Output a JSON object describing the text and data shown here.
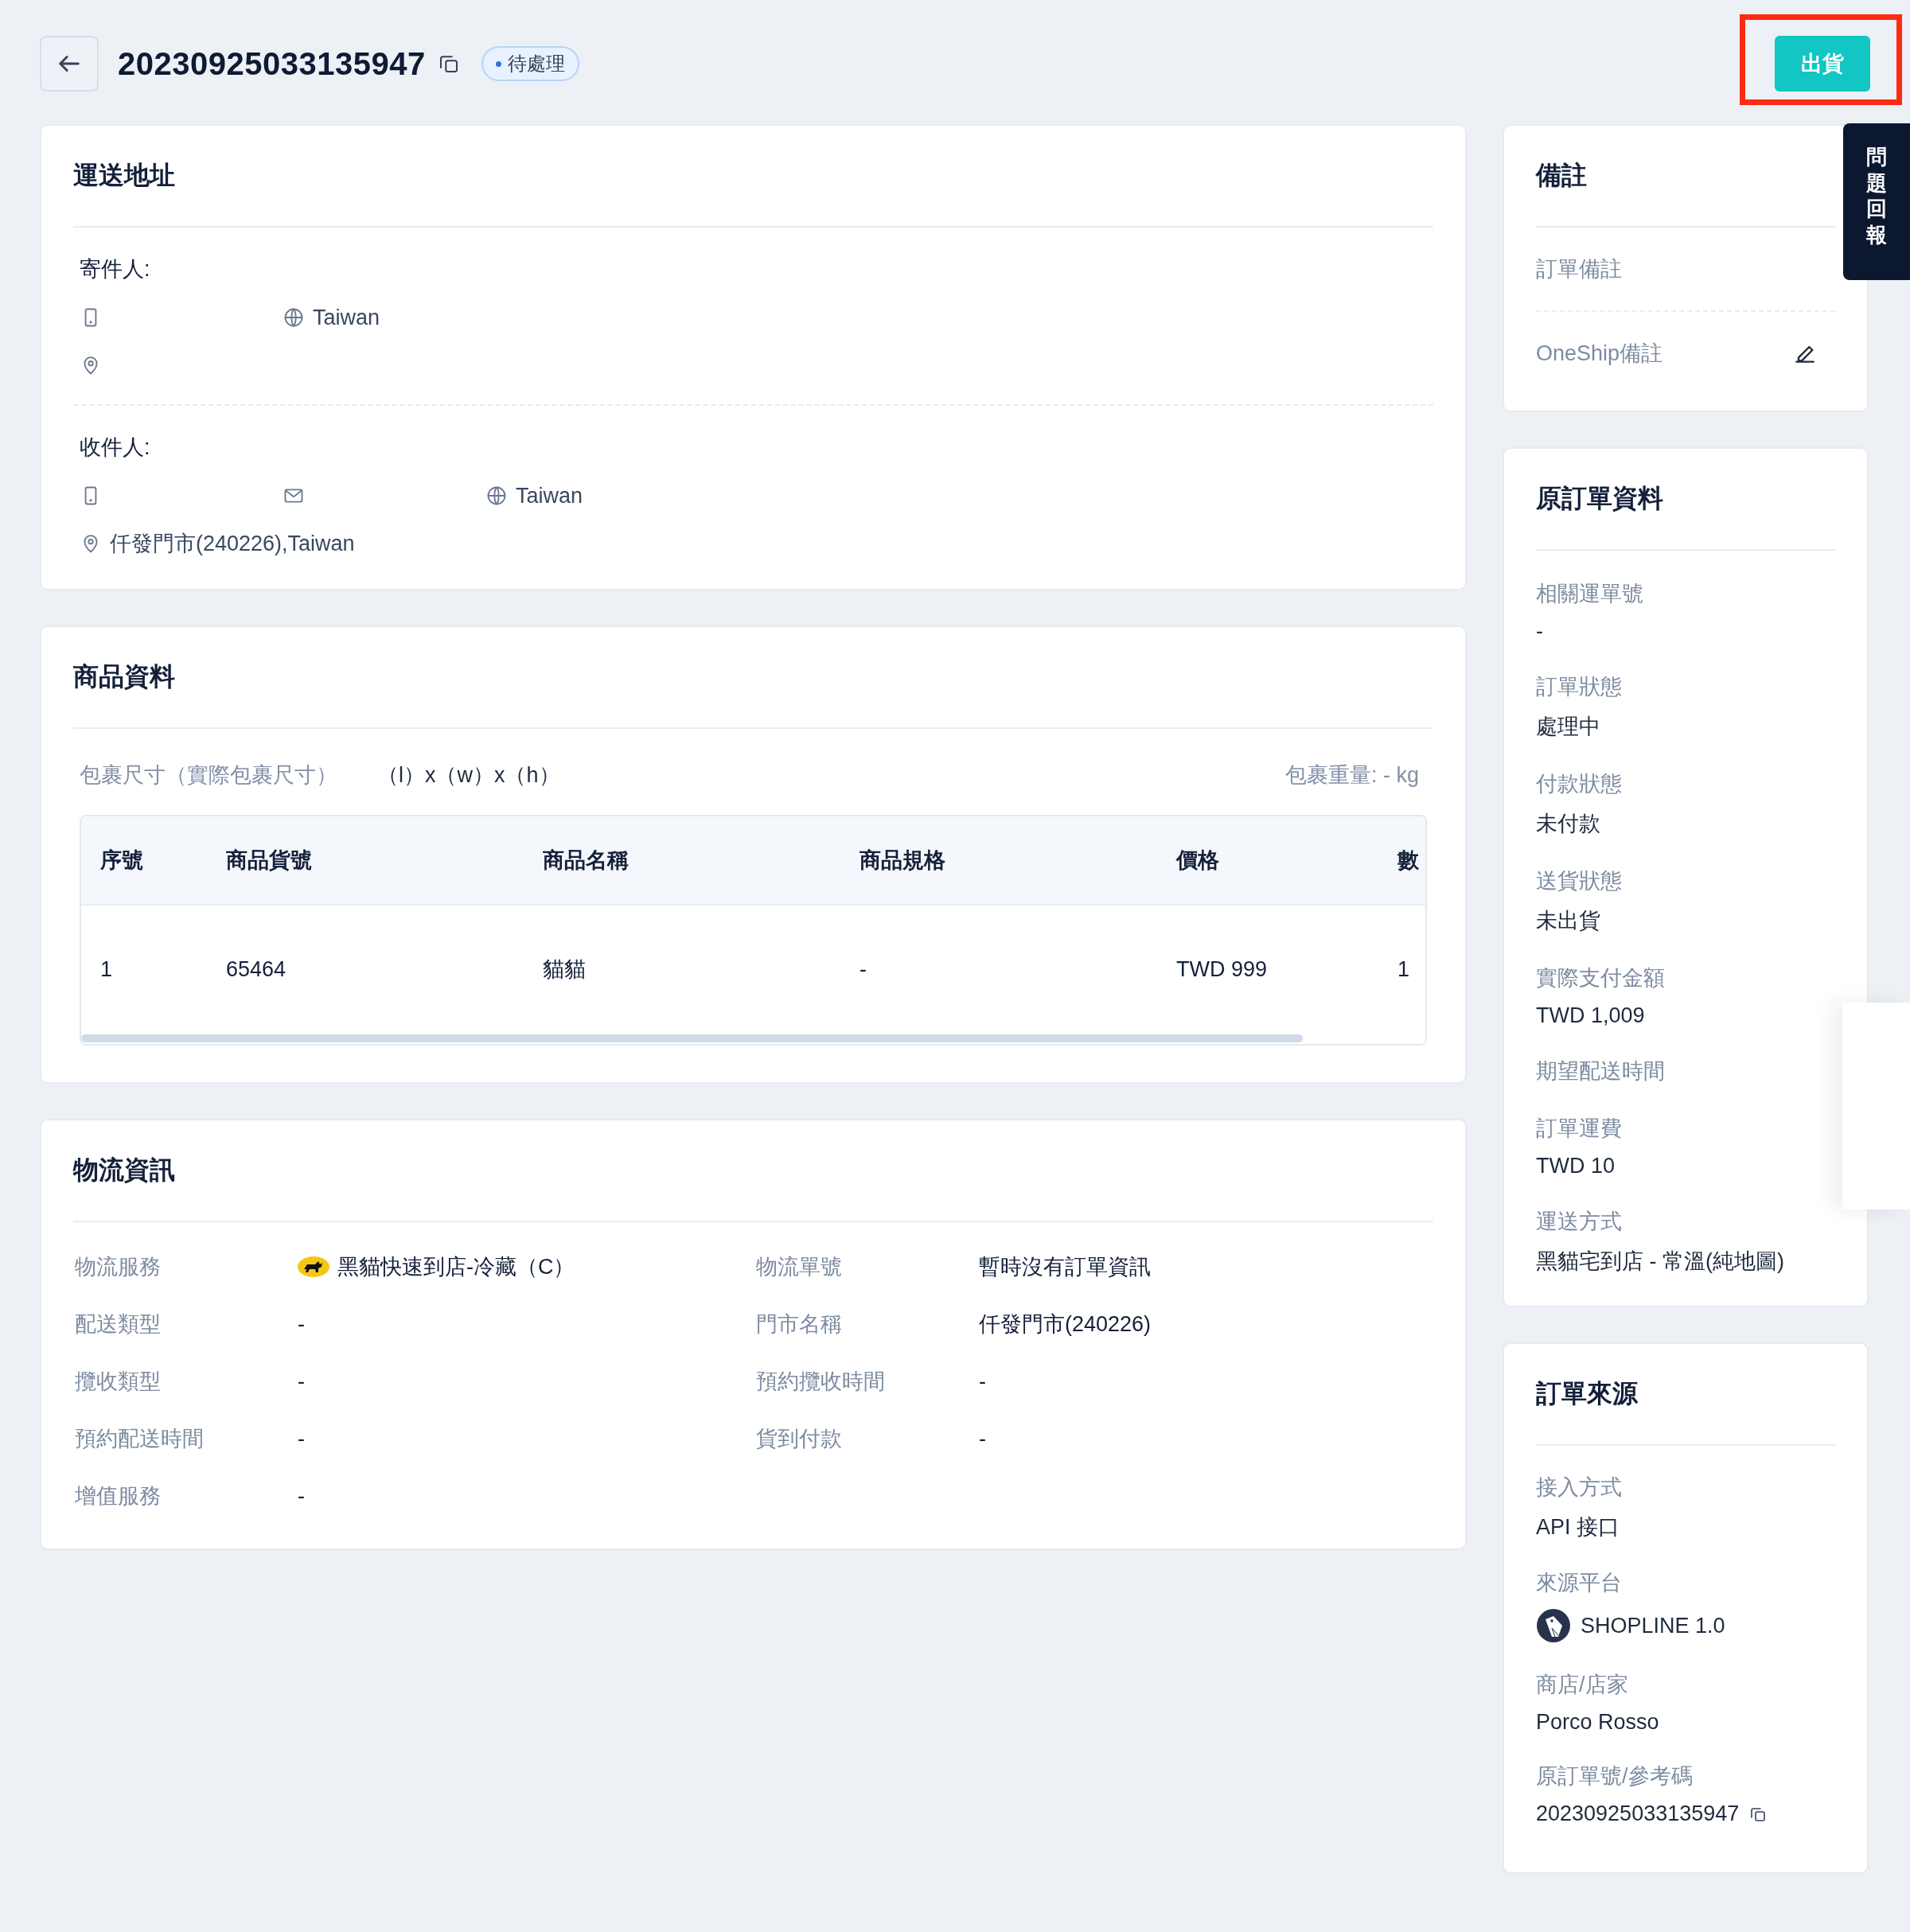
{
  "header": {
    "order_number": "20230925033135947",
    "status": "待處理",
    "ship_button": "出貨",
    "feedback_tab": "問題回報"
  },
  "shipping_address": {
    "title": "運送地址",
    "parties": [
      {
        "label": "寄件人:",
        "contacts": [
          {
            "kind": "phone"
          },
          {
            "kind": "country",
            "text": "Taiwan"
          }
        ]
      },
      {
        "label": "收件人:",
        "contacts": [
          {
            "kind": "phone"
          },
          {
            "kind": "email"
          },
          {
            "kind": "country",
            "text": "Taiwan"
          }
        ],
        "address": "仟發門市(240226),Taiwan"
      }
    ]
  },
  "products": {
    "title": "商品資料",
    "size_label": "包裹尺寸（實際包裹尺寸）",
    "size_value": "（l）x（w）x（h）",
    "weight": "包裹重量: - kg",
    "columns": [
      "序號",
      "商品貨號",
      "商品名稱",
      "商品規格",
      "價格",
      "數"
    ],
    "rows": [
      [
        "1",
        "65464",
        "貓貓",
        "-",
        "TWD 999",
        "1"
      ]
    ]
  },
  "logistics": {
    "title": "物流資訊",
    "left": [
      {
        "label": "物流服務",
        "value": "黑貓快速到店-冷藏（C）",
        "kind": "carrier"
      },
      {
        "label": "配送類型",
        "value": "-"
      },
      {
        "label": "攬收類型",
        "value": "-"
      },
      {
        "label": "預約配送時間",
        "value": "-"
      },
      {
        "label": "增值服務",
        "value": "-"
      }
    ],
    "right": [
      {
        "label": "物流單號",
        "value": "暫時沒有訂單資訊"
      },
      {
        "label": "門市名稱",
        "value": "仟發門市(240226)"
      },
      {
        "label": "預約攬收時間",
        "value": "-"
      },
      {
        "label": "貨到付款",
        "value": "-"
      }
    ]
  },
  "notes": {
    "title": "備註",
    "items": [
      {
        "label": "訂單備註",
        "editable": false
      },
      {
        "label": "OneShip備註",
        "editable": true
      }
    ]
  },
  "original_order": {
    "title": "原訂單資料",
    "fields": [
      {
        "label": "相關運單號",
        "value": "-"
      },
      {
        "label": "訂單狀態",
        "value": "處理中"
      },
      {
        "label": "付款狀態",
        "value": "未付款"
      },
      {
        "label": "送貨狀態",
        "value": "未出貨"
      },
      {
        "label": "實際支付金額",
        "value": "TWD 1,009"
      },
      {
        "label": "期望配送時間"
      },
      {
        "label": "訂單運費",
        "value": "TWD 10"
      },
      {
        "label": "運送方式",
        "value": "黑貓宅到店 - 常溫(純地圖)"
      }
    ]
  },
  "order_source": {
    "title": "訂單來源",
    "fields": [
      {
        "label": "接入方式",
        "value": "API 接口",
        "kind": "text"
      },
      {
        "label": "來源平台",
        "value": "SHOPLINE 1.0",
        "kind": "platform"
      },
      {
        "label": "商店/店家",
        "value": "Porco Rosso",
        "kind": "text"
      },
      {
        "label": "原訂單號/參考碼",
        "value": "20230925033135947",
        "kind": "copyable"
      }
    ]
  }
}
